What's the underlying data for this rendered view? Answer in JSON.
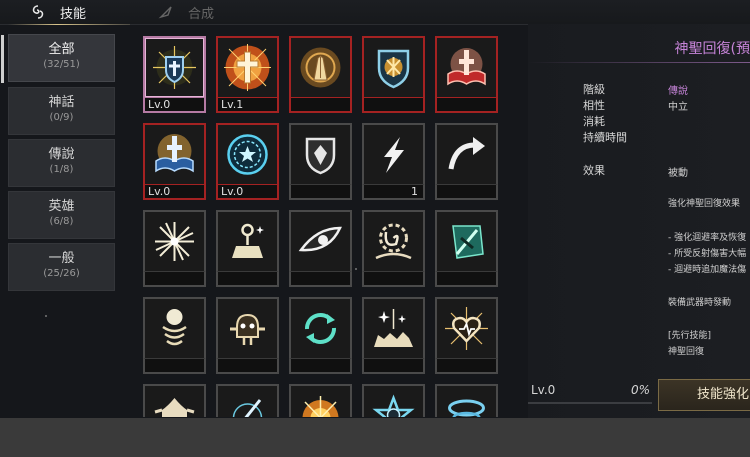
{
  "tabs": [
    {
      "label": "技能",
      "icon": "spiral-emblem-icon",
      "active": true
    },
    {
      "label": "合成",
      "icon": "quill-icon",
      "active": false
    }
  ],
  "categories": [
    {
      "name": "全部",
      "count": "(32/51)"
    },
    {
      "name": "神話",
      "count": "(0/9)"
    },
    {
      "name": "傳說",
      "count": "(1/8)"
    },
    {
      "name": "英雄",
      "count": "(6/8)"
    },
    {
      "name": "一般",
      "count": "(25/26)"
    }
  ],
  "skills": [
    {
      "icon": "holy-shield-cross-icon",
      "level": "Lv.0",
      "count": ""
    },
    {
      "icon": "radiant-cross-icon",
      "level": "Lv.1",
      "count": ""
    },
    {
      "icon": "praying-hands-icon",
      "level": "",
      "count": ""
    },
    {
      "icon": "sigil-shield-icon",
      "level": "",
      "count": ""
    },
    {
      "icon": "holy-book-red-icon",
      "level": "",
      "count": ""
    },
    {
      "icon": "holy-book-blue-icon",
      "level": "Lv.0",
      "count": ""
    },
    {
      "icon": "star-circle-icon",
      "level": "Lv.0",
      "count": ""
    },
    {
      "icon": "guard-shield-icon",
      "level": "",
      "count": ""
    },
    {
      "icon": "lightning-bolt-icon",
      "level": "",
      "count": "1"
    },
    {
      "icon": "curved-arrow-icon",
      "level": "",
      "count": ""
    },
    {
      "icon": "starburst-icon",
      "level": "",
      "count": ""
    },
    {
      "icon": "ankh-altar-icon",
      "level": "",
      "count": ""
    },
    {
      "icon": "eye-icon",
      "level": "",
      "count": ""
    },
    {
      "icon": "spiked-spiral-icon",
      "level": "",
      "count": ""
    },
    {
      "icon": "slashed-feather-icon",
      "level": "",
      "count": ""
    },
    {
      "icon": "orb-pedestal-icon",
      "level": "",
      "count": ""
    },
    {
      "icon": "spirit-face-icon",
      "level": "",
      "count": ""
    },
    {
      "icon": "cycle-arrows-icon",
      "level": "",
      "count": ""
    },
    {
      "icon": "sparkle-ground-icon",
      "level": "",
      "count": ""
    },
    {
      "icon": "winged-heart-icon",
      "level": "",
      "count": ""
    },
    {
      "icon": "winged-crest-icon",
      "level": "",
      "count": ""
    },
    {
      "icon": "sword-strike-icon",
      "level": "",
      "count": ""
    },
    {
      "icon": "sunburst-icon",
      "level": "",
      "count": ""
    },
    {
      "icon": "star-seal-icon",
      "level": "",
      "count": ""
    },
    {
      "icon": "vortex-icon",
      "level": "",
      "count": ""
    }
  ],
  "detail": {
    "title": "神聖回復(預",
    "grade_label": "階級",
    "grade_value": "傳說",
    "affinity_label": "相性",
    "affinity_value": "中立",
    "cost_label": "消耗",
    "duration_label": "持續時間",
    "effect_label": "效果",
    "effect_value": "被動",
    "desc1": "強化神聖回復效果",
    "desc2": "- 強化迴避率及恢復",
    "desc3": "- 所受反射傷害大幅",
    "desc4": "- 迴避時追加魔法傷",
    "desc5": "裝備武器時發動",
    "prereq_label": "[先行技能]",
    "prereq_value": "神聖回復",
    "level": "Lv.0",
    "progress": "0%",
    "enhance_label": "技能強化"
  },
  "colors": {
    "legendary": "#c684d8",
    "red_frame": "#a42222",
    "selected_frame": "#b57aa4"
  }
}
